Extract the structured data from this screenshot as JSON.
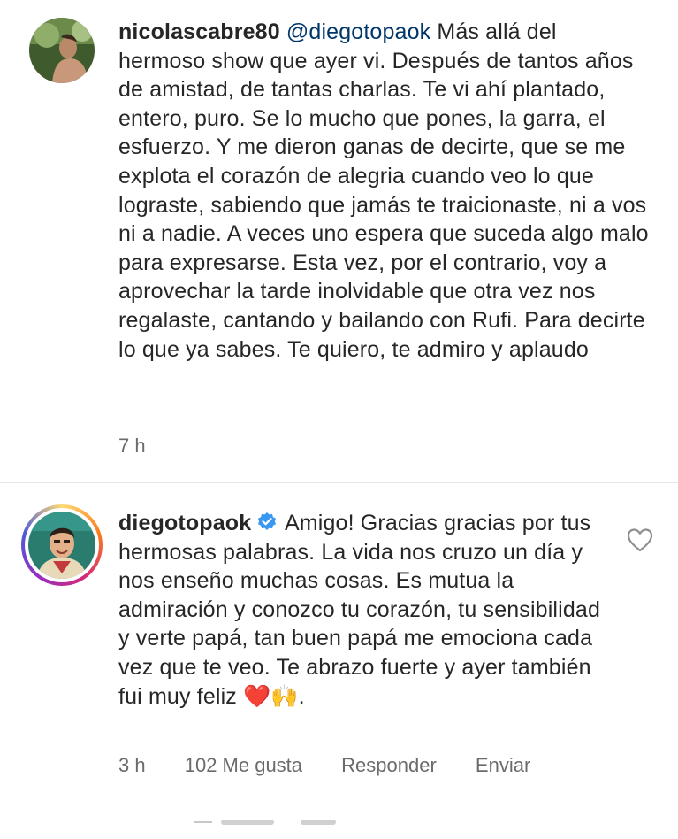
{
  "comment1": {
    "username": "nicolascabre80",
    "mention": "@diegotopaok",
    "text": "Más allá del hermoso show que ayer vi. Después de tantos años de amistad, de tantas charlas. Te vi ahí plantado, entero, puro. Se lo mucho que pones, la garra, el esfuerzo. Y me dieron ganas de decirte, que se me explota el corazón de alegria cuando veo lo que lograste, sabiendo que jamás te traicionaste, ni a vos ni a nadie. A veces uno espera que suceda algo malo para expresarse. Esta vez, por el contrario, voy a aprovechar la tarde inolvidable que otra vez nos regalaste, cantando y bailando con Rufi. Para decirte lo que ya sabes. Te quiero, te admiro y aplaudo",
    "time": "7 h"
  },
  "comment2": {
    "username": "diegotopaok",
    "text": "Amigo! Gracias gracias por tus hermosas palabras. La vida nos cruzo un día y nos enseño muchas cosas. Es mutua la admiración y conozco tu corazón, tu sensibilidad y verte papá, tan buen papá me emociona cada vez que te veo. Te abrazo fuerte y ayer también fui muy feliz ",
    "emoji": "❤️🙌.",
    "time": "3 h",
    "likes": "102 Me gusta",
    "reply_label": "Responder",
    "send_label": "Enviar"
  },
  "colors": {
    "mention": "#00376b",
    "verified": "#3897f0",
    "meta": "#6b6b6b"
  },
  "icons": [
    "verified-badge-icon",
    "heart-outline-icon"
  ]
}
